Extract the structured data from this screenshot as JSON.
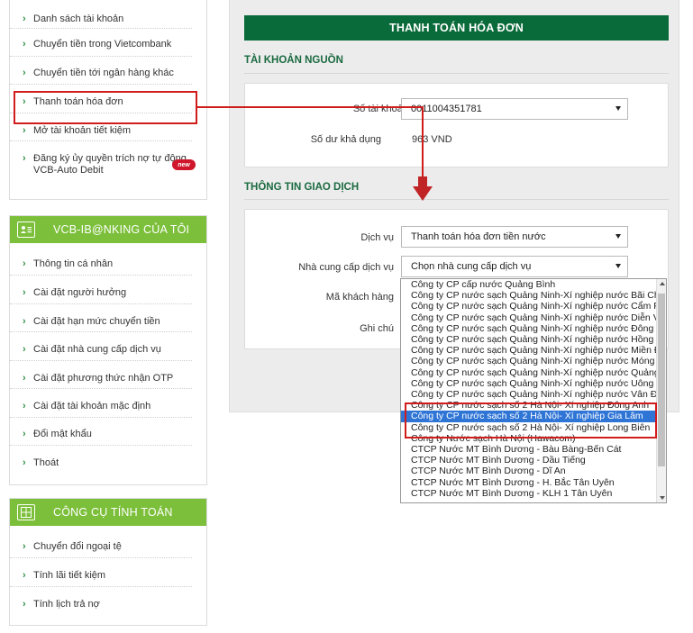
{
  "sidebar": {
    "account_menu": {
      "items": [
        {
          "label": "Danh sách tài khoản"
        },
        {
          "label": "Chuyển tiền trong Vietcombank"
        },
        {
          "label": "Chuyển tiền tới ngân hàng khác"
        },
        {
          "label": "Thanh toán hóa đơn"
        },
        {
          "label": "Mở tài khoản tiết kiệm"
        },
        {
          "label": "Đăng ký ủy quyền trích nợ tự động",
          "label_line2": "VCB-Auto Debit",
          "badge": "new"
        }
      ]
    },
    "my_ibanking": {
      "title": "VCB-IB@NKING CỦA TÔI",
      "icon": "user-card-icon",
      "items": [
        {
          "label": "Thông tin cá nhân"
        },
        {
          "label": "Cài đặt người hưởng"
        },
        {
          "label": "Cài đặt hạn mức chuyển tiền"
        },
        {
          "label": "Cài đặt nhà cung cấp dịch vụ"
        },
        {
          "label": "Cài đặt phương thức nhận OTP"
        },
        {
          "label": "Cài đặt tài khoản mặc định"
        },
        {
          "label": "Đổi mật khẩu"
        },
        {
          "label": "Thoát"
        }
      ]
    },
    "tools": {
      "title": "CÔNG CỤ TÍNH TOÁN",
      "icon": "calculator-icon",
      "items": [
        {
          "label": "Chuyển đổi ngoại tệ"
        },
        {
          "label": "Tính lãi tiết kiệm"
        },
        {
          "label": "Tính lịch trả nợ"
        }
      ]
    }
  },
  "main": {
    "title": "THANH TOÁN HÓA ĐƠN",
    "source_section": {
      "heading": "TÀI KHOẢN NGUỒN",
      "account_label": "Số tài khoản",
      "account_value": "0011004351781",
      "balance_label": "Số dư khả dụng",
      "balance_value": "963 VND"
    },
    "transaction_section": {
      "heading": "THÔNG TIN GIAO DỊCH",
      "service_label": "Dịch vụ",
      "service_value": "Thanh toán hóa đơn tiền nước",
      "provider_label": "Nhà cung cấp dịch vụ",
      "provider_placeholder": "Chọn nhà cung cấp dịch vụ",
      "customer_code_label": "Mã khách hàng",
      "note_label": "Ghi chú"
    },
    "provider_options": [
      "Công ty CP cấp nước Quảng Bình",
      "Công ty CP nước sạch Quảng Ninh-Xí nghiệp nước Bãi Cháy",
      "Công ty CP nước sạch Quảng Ninh-Xí nghiệp nước Cẩm Phả",
      "Công ty CP nước sạch Quảng Ninh-Xí nghiệp nước Diễn Vọng",
      "Công ty CP nước sạch Quảng Ninh-Xí nghiệp nước Đông Triều",
      "Công ty CP nước sạch Quảng Ninh-Xí nghiệp nước Hồng Gai",
      "Công ty CP nước sạch Quảng Ninh-Xí nghiệp nước Miền Đông",
      "Công ty CP nước sạch Quảng Ninh-Xí nghiệp nước Móng Cái",
      "Công ty CP nước sạch Quảng Ninh-Xí nghiệp nước Quảng Yên",
      "Công ty CP nước sạch Quảng Ninh-Xí nghiệp nước Uông Bí",
      "Công ty CP nước sạch Quảng Ninh-Xí nghiệp nước Vân Đồn",
      "Công ty CP nước sạch số 2 Hà Nội- Xí nghiệp Đông Anh",
      "Công ty CP nước sạch số 2 Hà Nội- Xí nghiệp Gia Lâm",
      "Công ty CP nước sạch số 2 Hà Nội- Xí nghiệp Long Biên",
      "Công ty Nước sạch Hà Nội (Hawacom)",
      "CTCP Nước MT Bình Dương - Bàu Bàng-Bến Cát",
      "CTCP Nước MT Bình Dương - Dầu Tiếng",
      "CTCP Nước MT Bình Dương - Dĩ An",
      "CTCP Nước MT Bình Dương - H. Bắc Tân Uyên",
      "CTCP Nước MT Bình Dương - KLH 1 Tân Uyên"
    ],
    "selected_option_index": 12
  },
  "colors": {
    "brand_green": "#0a6b3a",
    "header_green": "#7cbf3a",
    "highlight_red": "#d11c1c",
    "selection_blue": "#2f75d6"
  }
}
